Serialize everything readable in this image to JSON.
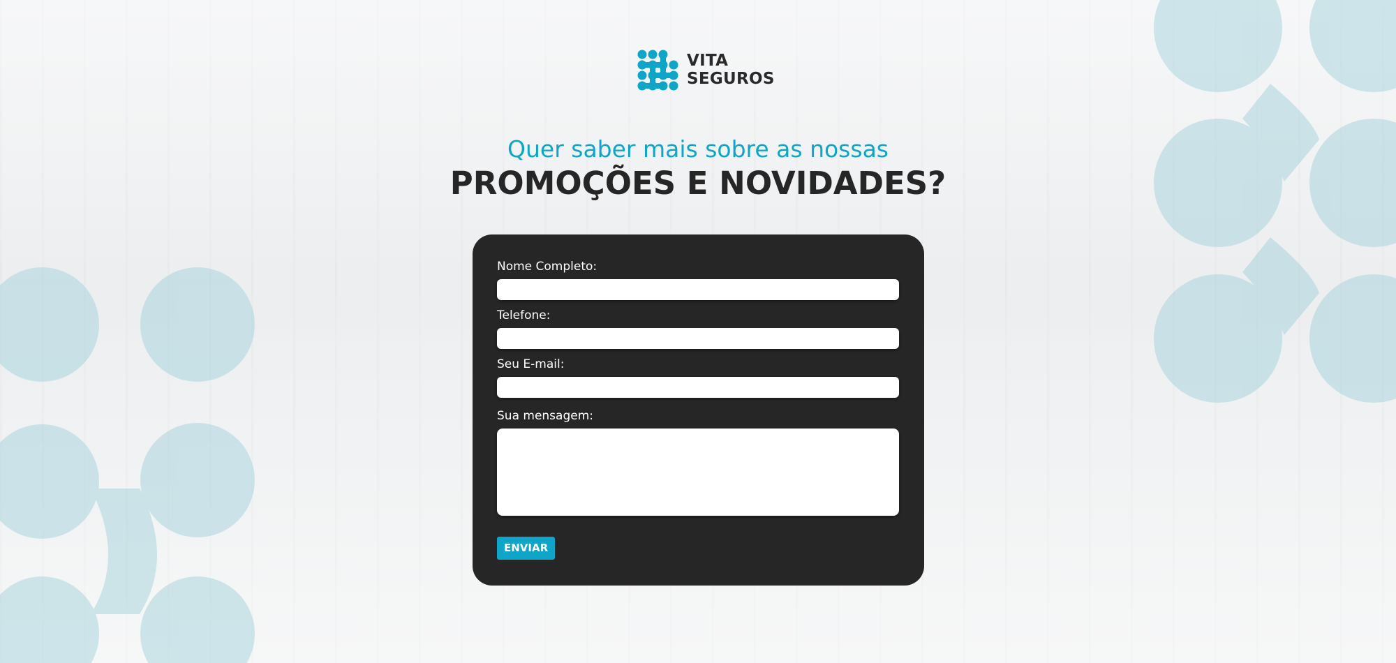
{
  "brand": {
    "line1": "VITA",
    "line2": "SEGUROS",
    "accent_color": "#0ea5c9",
    "icon": "dot-network-logo-icon"
  },
  "headline": {
    "subtitle": "Quer saber mais sobre as nossas",
    "title": "PROMOÇÕES E NOVIDADES?"
  },
  "form": {
    "fields": [
      {
        "label": "Nome Completo:",
        "value": "",
        "type": "text"
      },
      {
        "label": "Telefone:",
        "value": "",
        "type": "tel"
      },
      {
        "label": "Seu E-mail:",
        "value": "",
        "type": "email"
      }
    ],
    "message": {
      "label": "Sua mensagem:",
      "value": ""
    },
    "submit_label": "ENVIAR",
    "card_color": "#262626"
  }
}
